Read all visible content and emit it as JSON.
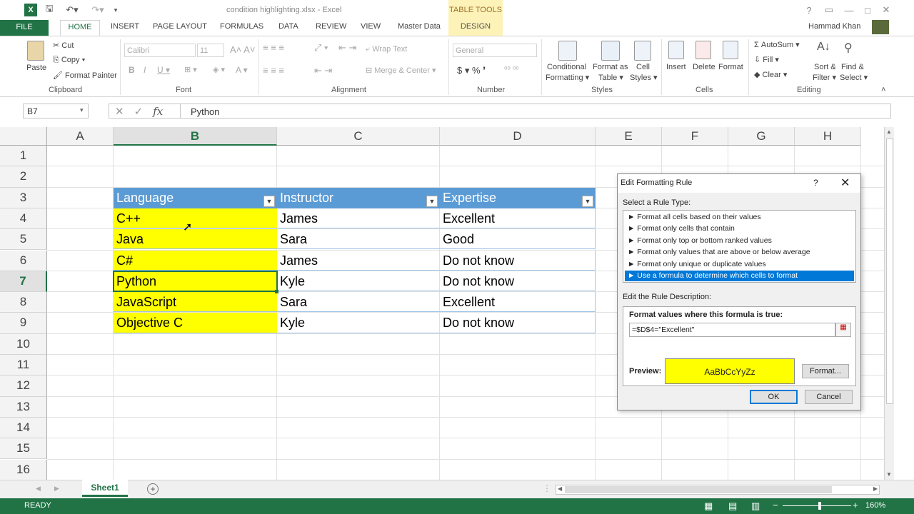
{
  "window": {
    "title": "condition highlighting.xlsx - Excel",
    "context_tab_group": "TABLE TOOLS",
    "user": "Hammad Khan",
    "controls": [
      "?",
      "▭",
      "—",
      "□",
      "✕"
    ]
  },
  "ribbon_tabs": [
    "FILE",
    "HOME",
    "INSERT",
    "PAGE LAYOUT",
    "FORMULAS",
    "DATA",
    "REVIEW",
    "VIEW",
    "Master Data",
    "DESIGN"
  ],
  "ribbon": {
    "clipboard": {
      "paste": "Paste",
      "cut": "Cut",
      "copy": "Copy",
      "format_painter": "Format Painter",
      "group": "Clipboard"
    },
    "font": {
      "font_name": "Calibri",
      "font_size": "11",
      "group": "Font"
    },
    "alignment": {
      "wrap_text": "Wrap Text",
      "merge_center": "Merge & Center",
      "group": "Alignment"
    },
    "number": {
      "format": "General",
      "group": "Number"
    },
    "styles": {
      "conditional_1": "Conditional",
      "conditional_2": "Formatting",
      "format_table_1": "Format as",
      "format_table_2": "Table",
      "cell_styles_1": "Cell",
      "cell_styles_2": "Styles",
      "group": "Styles"
    },
    "cells": {
      "insert": "Insert",
      "delete": "Delete",
      "format": "Format",
      "group": "Cells"
    },
    "editing": {
      "autosum": "AutoSum",
      "fill": "Fill",
      "clear": "Clear",
      "sort_1": "Sort &",
      "sort_2": "Filter",
      "find_1": "Find &",
      "find_2": "Select",
      "group": "Editing"
    }
  },
  "formula_bar": {
    "name_box": "B7",
    "fx": "fx",
    "content": "Python"
  },
  "columns": [
    "A",
    "B",
    "C",
    "D",
    "E",
    "F",
    "G",
    "H"
  ],
  "rows": [
    "1",
    "2",
    "3",
    "4",
    "5",
    "6",
    "7",
    "8",
    "9",
    "10",
    "11",
    "12",
    "13",
    "14",
    "15",
    "16"
  ],
  "table": {
    "headers": [
      "Language",
      "Instructor",
      "Expertise"
    ],
    "rows": [
      [
        "C++",
        "James",
        "Excellent"
      ],
      [
        "Java",
        "Sara",
        "Good"
      ],
      [
        "C#",
        "James",
        "Do not know"
      ],
      [
        "Python",
        "Kyle",
        "Do not know"
      ],
      [
        "JavaScript",
        "Sara",
        "Excellent"
      ],
      [
        "Objective C",
        "Kyle",
        "Do not know"
      ]
    ],
    "highlight_color": "#ffff00",
    "header_color": "#5b9bd5"
  },
  "sheet_tabs": [
    "Sheet1"
  ],
  "status": {
    "left": "READY",
    "zoom": "160%"
  },
  "dialog": {
    "title": "Edit Formatting Rule",
    "help": "?",
    "select_rule_type": "Select a Rule Type:",
    "rule_types": [
      "► Format all cells based on their values",
      "► Format only cells that contain",
      "► Format only top or bottom ranked values",
      "► Format only values that are above or below average",
      "► Format only unique or duplicate values",
      "► Use a formula to determine which cells to format"
    ],
    "edit_desc": "Edit the Rule Description:",
    "formula_label": "Format values where this formula is true:",
    "formula": "=$D$4=\"Excellent\"",
    "preview_label": "Preview:",
    "preview_text": "AaBbCcYyZz",
    "format_button": "Format...",
    "ok": "OK",
    "cancel": "Cancel"
  }
}
